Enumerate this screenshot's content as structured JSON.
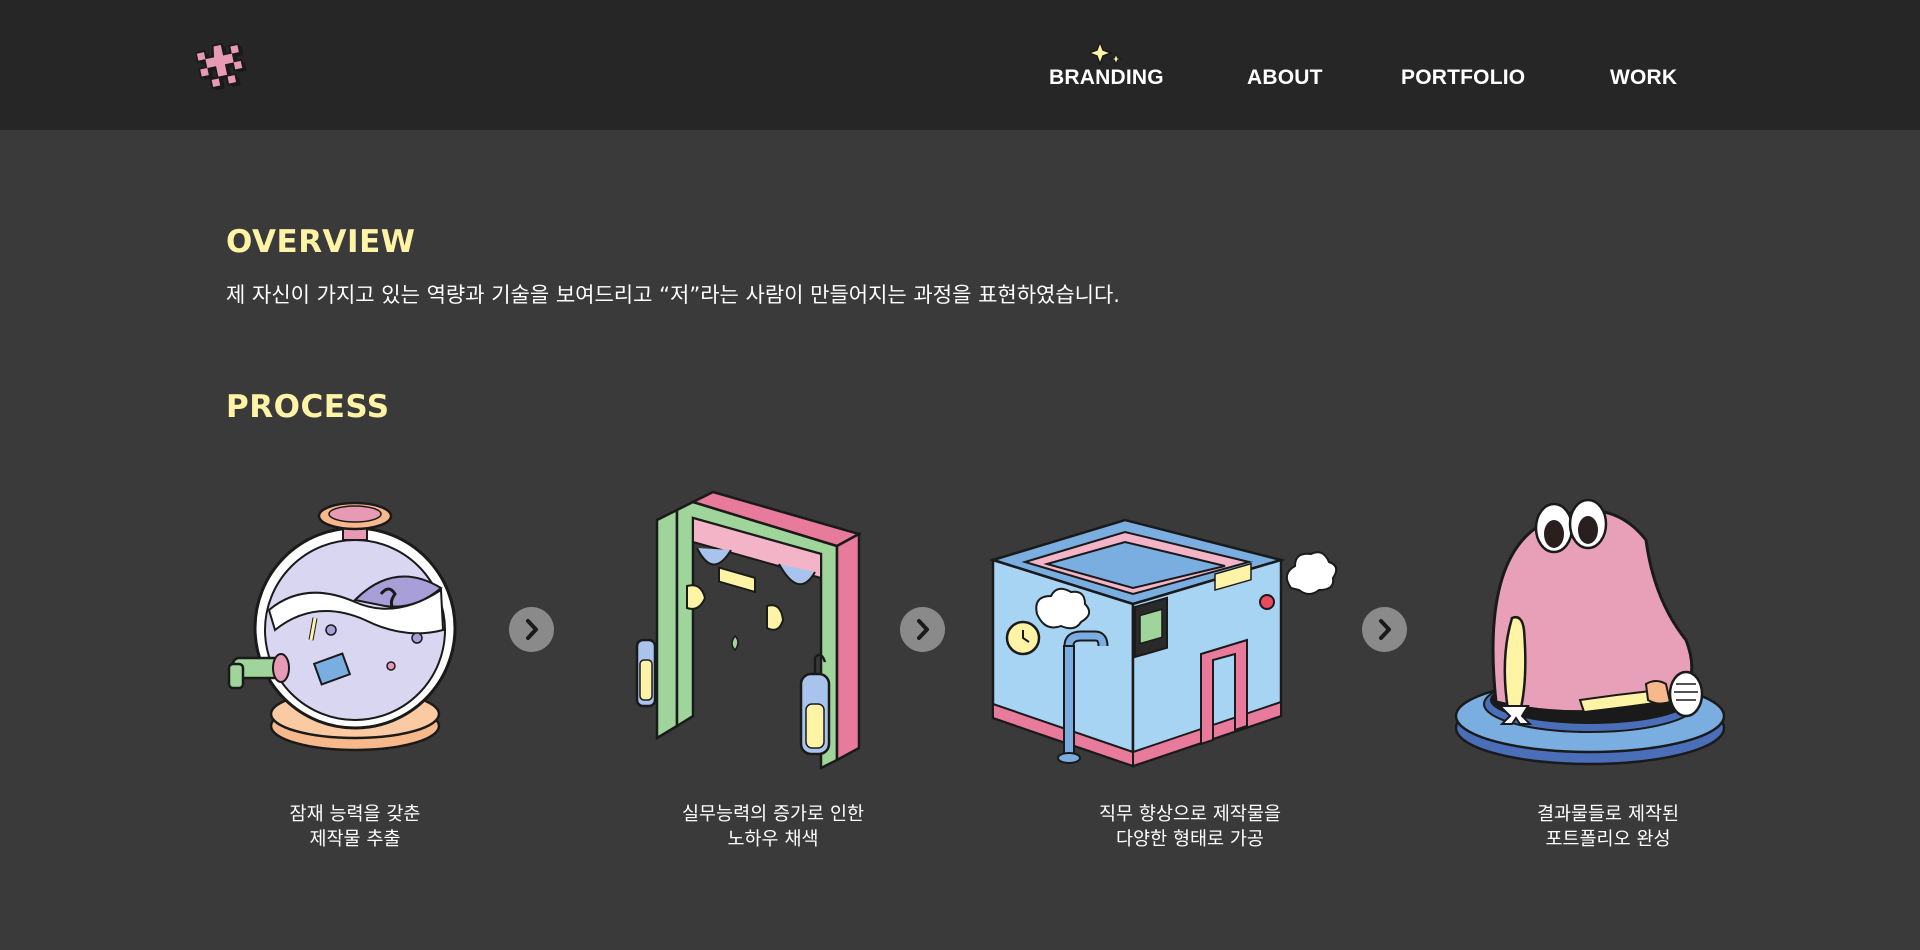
{
  "header": {
    "logo_icon": "puzzle-hash-logo-icon",
    "nav": [
      {
        "label": "BRANDING",
        "active": true
      },
      {
        "label": "ABOUT"
      },
      {
        "label": "PORTFOLIO"
      },
      {
        "label": "WORK"
      }
    ],
    "active_indicator_icon": "sparkle-icon"
  },
  "overview": {
    "title": "OVERVIEW",
    "text": "제 자신이 가지고 있는 역량과 기술을 보여드리고 “저”라는 사람이 만들어지는 과정을 표현하였습니다."
  },
  "process": {
    "title": "PROCESS",
    "steps": [
      {
        "icon": "gumball-machine-icon",
        "caption_line1": "잠재 능력을 갖춘",
        "caption_line2": "제작물 추출"
      },
      {
        "icon": "gate-arch-icon",
        "caption_line1": "실무능력의 증가로 인한",
        "caption_line2": "노하우 채색"
      },
      {
        "icon": "factory-box-icon",
        "caption_line1": "직무 향상으로 제작물을",
        "caption_line2": "다양한 형태로 가공"
      },
      {
        "icon": "pink-blob-character-icon",
        "caption_line1": "결과물들로 제작된",
        "caption_line2": "포트폴리오 완성"
      }
    ],
    "arrow_icon": "chevron-right-icon"
  },
  "colors": {
    "header_bg": "#262626",
    "page_bg": "#3a3a3a",
    "title_accent": "#fff3a6",
    "pink": "#e89ab5",
    "blue": "#7aaee0",
    "green": "#9fd49a",
    "peach": "#f7b98c"
  }
}
